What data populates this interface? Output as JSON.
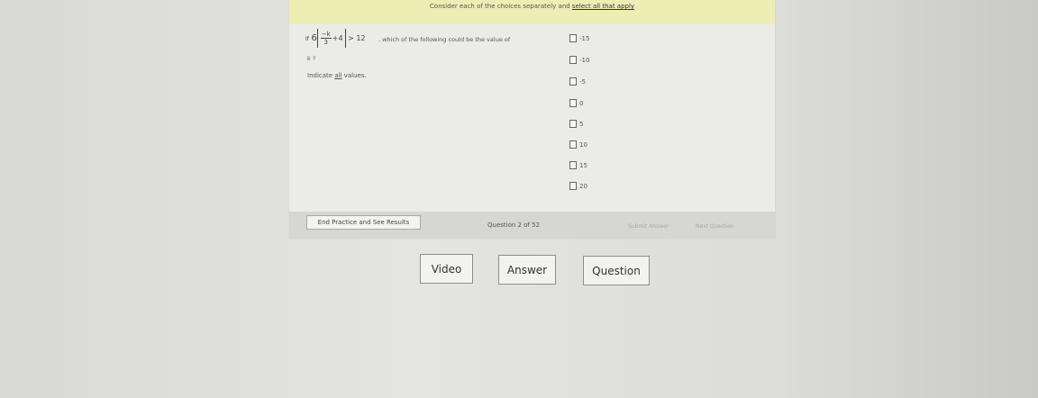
{
  "instructions": {
    "prefix": "Consider each of the choices separately and ",
    "emphasis": "select all that apply"
  },
  "question": {
    "if": "If",
    "coef": "6",
    "numerator": "−k",
    "denominator": "3",
    "plus_term": "+4",
    "inequality": "> 12",
    "text": ", which of the following could be the value of",
    "variable": "k ?",
    "indicate_prefix": "Indicate ",
    "indicate_emphasis": "all",
    "indicate_suffix": " values."
  },
  "choices": [
    "-15",
    "-10",
    "-5",
    "0",
    "5",
    "10",
    "15",
    "20"
  ],
  "footer": {
    "end_practice": "End Practice and See Results",
    "question_count": "Question 2 of 52",
    "submit": "Submit Answer",
    "next": "Next Question"
  },
  "tabs": {
    "video": "Video",
    "answer": "Answer",
    "question": "Question"
  }
}
